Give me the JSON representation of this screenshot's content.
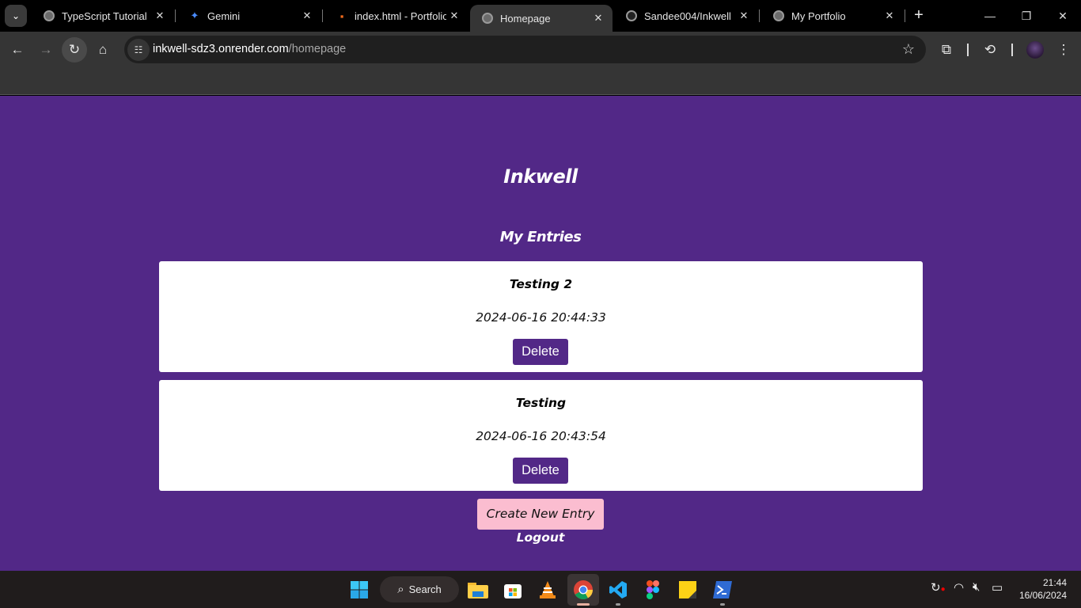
{
  "browser": {
    "tabs": [
      {
        "title": "TypeScript Tutorial",
        "icon": "globe-icon",
        "active": false
      },
      {
        "title": "Gemini",
        "icon": "gemini-icon",
        "active": false
      },
      {
        "title": "index.html - Portfolio",
        "icon": "code-editor-icon",
        "active": false
      },
      {
        "title": "Homepage",
        "icon": "globe-icon",
        "active": true
      },
      {
        "title": "Sandee004/Inkwell",
        "icon": "github-icon",
        "active": false
      },
      {
        "title": "My Portfolio",
        "icon": "globe-icon",
        "active": false
      }
    ],
    "url_host": "inkwell-sdz3.onrender.com",
    "url_path": "/homepage"
  },
  "app": {
    "title": "Inkwell",
    "section_title": "My Entries",
    "entries": [
      {
        "title": "Testing 2",
        "date": "2024-06-16 20:44:33",
        "delete_label": "Delete"
      },
      {
        "title": "Testing",
        "date": "2024-06-16 20:43:54",
        "delete_label": "Delete"
      }
    ],
    "create_label": "Create New Entry",
    "logout_label": "Logout",
    "colors": {
      "background": "#522887",
      "create_button": "#fbbdd0",
      "delete_button": "#522887"
    }
  },
  "taskbar": {
    "search_label": "Search",
    "time": "21:44",
    "date": "16/06/2024"
  }
}
